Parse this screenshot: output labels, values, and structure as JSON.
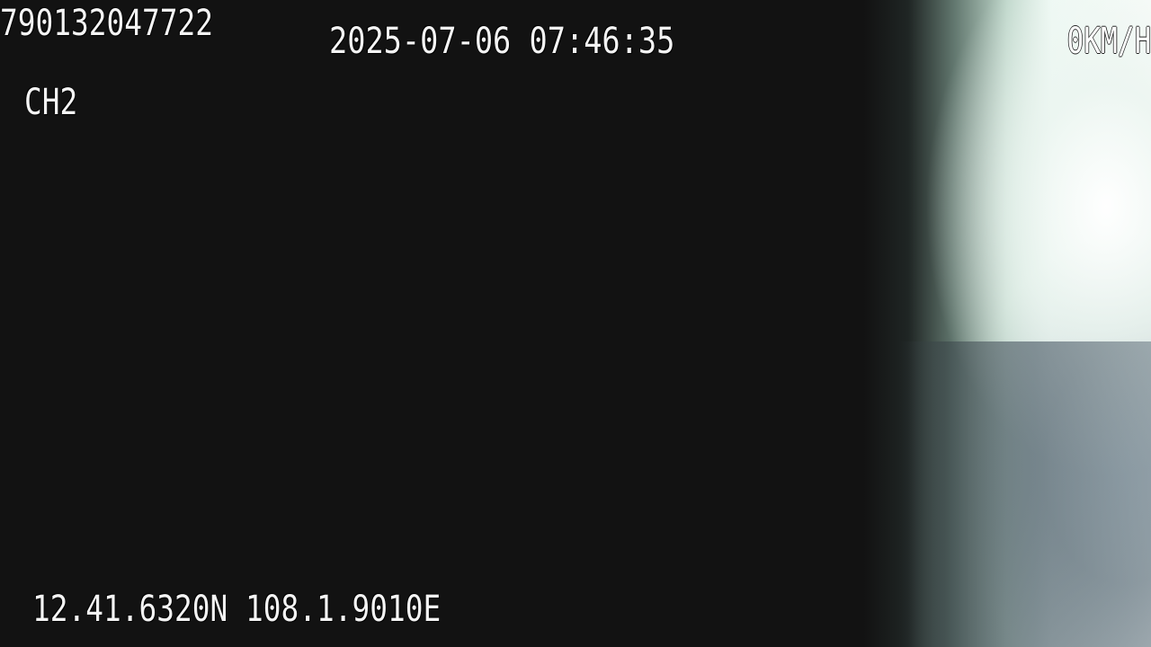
{
  "overlay": {
    "device_id": "790132047722",
    "timestamp": "2025-07-06 07:46:35",
    "channel": "CH2",
    "speed": "0KM/H",
    "gps": "12.41.6320N 108.1.9010E"
  }
}
